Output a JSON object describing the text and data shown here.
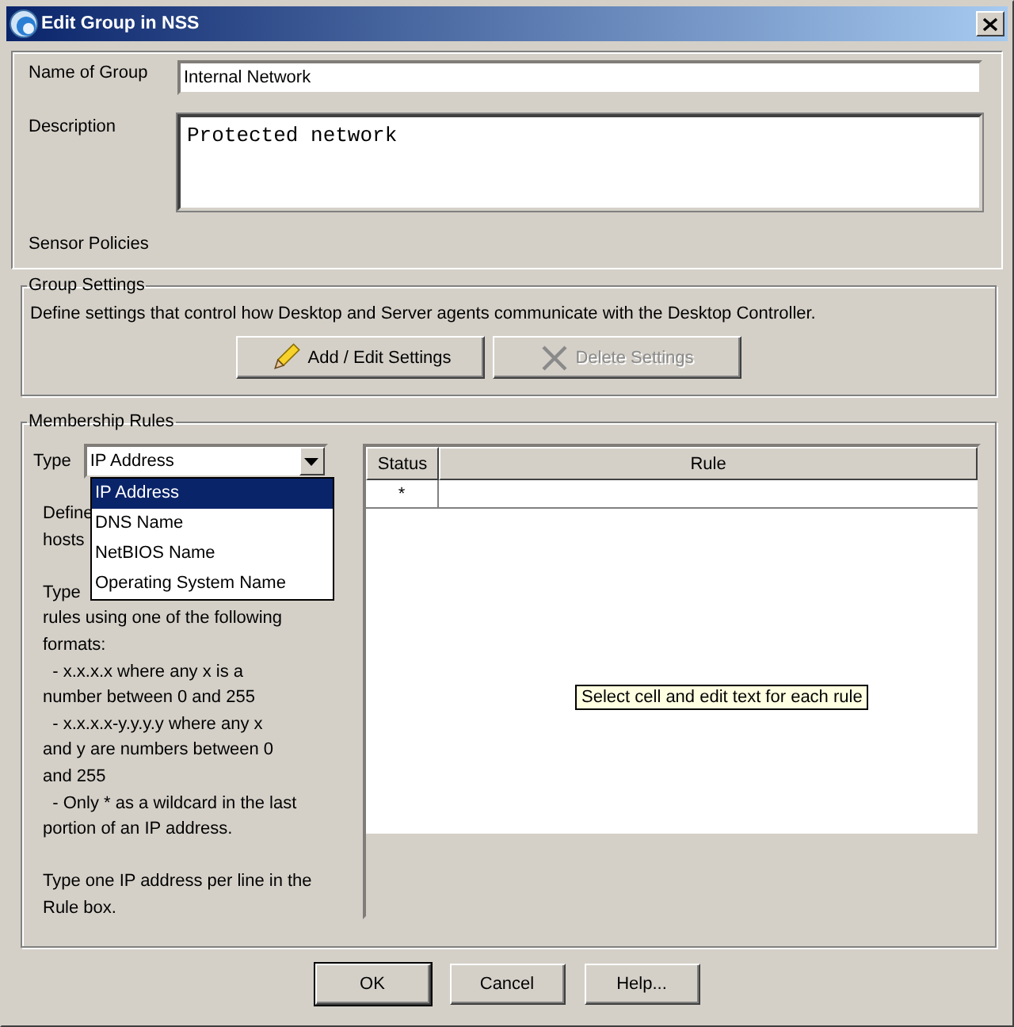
{
  "window": {
    "title": "Edit Group in NSS"
  },
  "fields": [
    {
      "label": "Name of Group",
      "value": "Internal Network",
      "kind": "line"
    },
    {
      "label": "Description",
      "value": "Protected network",
      "kind": "area"
    }
  ],
  "sensor_policies": {
    "label": "Sensor Policies"
  },
  "group_settings": {
    "title": "Group Settings",
    "description": "Define settings that control how Desktop and Server agents communicate with the Desktop Controller.",
    "buttons": [
      {
        "label": "Add / Edit Settings",
        "kind": "pencil",
        "disabled": false
      },
      {
        "label": "Delete Settings",
        "kind": "cross",
        "disabled": true
      }
    ]
  },
  "membership_rules": {
    "title": "Membership Rules",
    "type_label": "Type",
    "type_value": "IP Address",
    "expanded": true,
    "type_options": [
      {
        "label": "IP Address",
        "selected": true
      },
      {
        "label": "DNS Name",
        "selected": false
      },
      {
        "label": "NetBIOS Name",
        "selected": false
      },
      {
        "label": "Operating System Name",
        "selected": false
      }
    ],
    "help": [
      [
        "Define",
        "hosts"
      ],
      [
        "Type",
        "rules using one of the following",
        "formats:",
        "  - x.x.x.x where any x is a",
        "number between 0 and 255",
        "  - x.x.x.x-y.y.y.y where any x",
        "and y are numbers between 0",
        "and 255",
        "  - Only * as a wildcard in the last",
        "portion of an IP address."
      ],
      [
        "Type one IP address per line in the",
        "Rule box."
      ]
    ],
    "table": {
      "columns": [
        "Status",
        "Rule"
      ],
      "rows": [
        {
          "status": "*"
        }
      ]
    },
    "tooltip": "Select cell and edit text for each rule"
  },
  "buttons": [
    {
      "label": "OK",
      "default": true
    },
    {
      "label": "Cancel",
      "default": false
    },
    {
      "label": "Help...",
      "default": false
    }
  ]
}
